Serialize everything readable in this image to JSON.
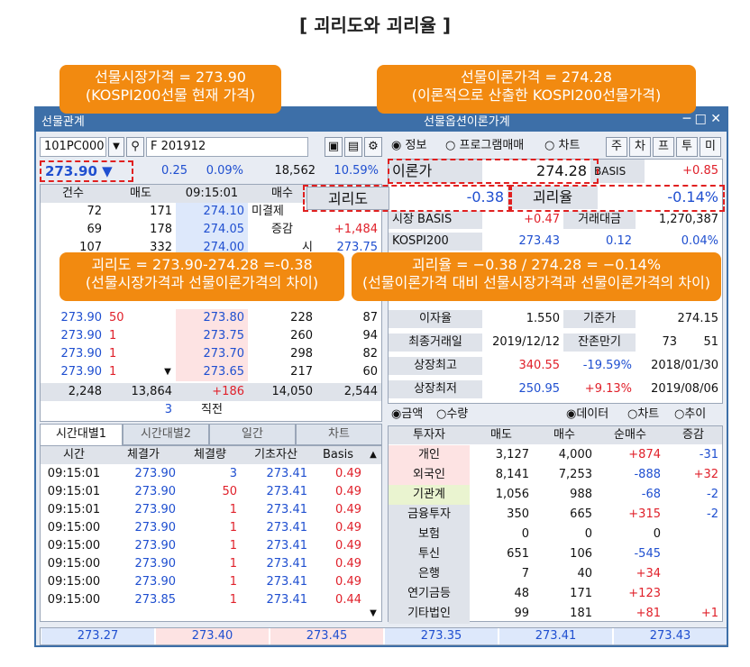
{
  "page_title": "[ 괴리도와 괴리율 ]",
  "window_title_left": "선물관계",
  "window_title_right": "선물옵션이론가계",
  "callouts": {
    "futures_price": [
      "선물시장가격 = 273.90",
      "(KOSPI200선물 현재 가격)"
    ],
    "theory_price": [
      "선물이론가격 = 274.28",
      "(이론적으로 산출한 KOSPI200선물가격)"
    ],
    "gap": [
      "괴리도 = 273.90-274.28 =-0.38",
      "(선물시장가격과 선물이론가격의 차이)"
    ],
    "gap_rate": [
      "괴리율 = −0.38 / 274.28 = −0.14%",
      "(선물이론가격 대비 선물시장가격과 선물이론가격의 차이)"
    ]
  },
  "left": {
    "code": "101PC000",
    "product": "F 201912",
    "price": "273.90 ▼",
    "change": "0.25",
    "change_pct": "0.09%",
    "volume": "18,562",
    "vol_pct": "10.59%",
    "quote_headers": [
      "건수",
      "매도",
      "09:15:01",
      "매수"
    ],
    "ask_rows": [
      [
        "72",
        "171",
        "274.10"
      ],
      [
        "69",
        "178",
        "274.05"
      ],
      [
        "107",
        "332",
        "274.00"
      ]
    ],
    "side_labels": [
      "미결제",
      "증감",
      "시"
    ],
    "side_values": [
      "+1,484",
      "273.75"
    ],
    "bid_rows": [
      [
        "273.90",
        "50",
        "273.80",
        "228",
        "87"
      ],
      [
        "273.90",
        "1",
        "273.75",
        "260",
        "94"
      ],
      [
        "273.90",
        "1",
        "273.70",
        "298",
        "82"
      ],
      [
        "273.90",
        "1",
        "273.65",
        "217",
        "60"
      ]
    ],
    "totals": [
      "2,248",
      "13,864",
      "+186",
      "14,050",
      "2,544"
    ],
    "footer": [
      "3",
      "직전"
    ],
    "tabs": [
      "시간대별1",
      "시간대별2",
      "일간",
      "차트"
    ],
    "trade_headers": [
      "시간",
      "체결가",
      "체결량",
      "기초자산",
      "Basis"
    ],
    "trades": [
      [
        "09:15:01",
        "273.90",
        "3",
        "273.41",
        "0.49"
      ],
      [
        "09:15:01",
        "273.90",
        "50",
        "273.41",
        "0.49"
      ],
      [
        "09:15:01",
        "273.90",
        "1",
        "273.41",
        "0.49"
      ],
      [
        "09:15:00",
        "273.90",
        "1",
        "273.41",
        "0.49"
      ],
      [
        "09:15:00",
        "273.90",
        "1",
        "273.41",
        "0.49"
      ],
      [
        "09:15:00",
        "273.90",
        "1",
        "273.41",
        "0.49"
      ],
      [
        "09:15:00",
        "273.90",
        "1",
        "273.41",
        "0.49"
      ],
      [
        "09:15:00",
        "273.85",
        "1",
        "273.41",
        "0.44"
      ]
    ]
  },
  "right": {
    "radios": [
      "정보",
      "프로그램매매",
      "차트"
    ],
    "buttons": [
      "주",
      "차",
      "프",
      "투",
      "미"
    ],
    "theory_label": "이론가",
    "theory_value": "274.28",
    "basis_label": "BASIS",
    "basis_value": "+0.85",
    "gap_label": "괴리도",
    "gap_value": "-0.38",
    "gap_rate_label": "괴리율",
    "gap_rate_value": "-0.14%",
    "market_basis_label": "시장 BASIS",
    "market_basis_value": "+0.47",
    "trade_amount_label": "거래대금",
    "trade_amount_value": "1,270,387",
    "kospi_label": "KOSPI200",
    "kospi_value": "273.43",
    "kospi_change": "0.12",
    "kospi_pct": "0.04%",
    "info_rows": [
      [
        "이자율",
        "1.550",
        "기준가",
        "274.15"
      ],
      [
        "최종거래일",
        "2019/12/12",
        "잔존만기",
        "73",
        "51"
      ],
      [
        "상장최고",
        "340.55",
        "-19.59%",
        "2018/01/30"
      ],
      [
        "상장최저",
        "250.95",
        "+9.13%",
        "2019/08/06"
      ]
    ],
    "radio_left": [
      "금액",
      "수량"
    ],
    "radio_right": [
      "데이터",
      "차트",
      "추이"
    ],
    "investor_headers": [
      "투자자",
      "매도",
      "매수",
      "순매수",
      "증감"
    ],
    "investors": [
      [
        "개인",
        "3,127",
        "4,000",
        "+874",
        "-31"
      ],
      [
        "외국인",
        "8,141",
        "7,253",
        "-888",
        "+32"
      ],
      [
        "기관계",
        "1,056",
        "988",
        "-68",
        "-2"
      ],
      [
        "금융투자",
        "350",
        "665",
        "+315",
        "-2"
      ],
      [
        "보험",
        "0",
        "0",
        "0",
        ""
      ],
      [
        "투신",
        "651",
        "106",
        "-545",
        ""
      ],
      [
        "은행",
        "7",
        "40",
        "+34",
        ""
      ],
      [
        "연기금등",
        "48",
        "171",
        "+123",
        ""
      ],
      [
        "기타법인",
        "99",
        "181",
        "+81",
        "+1"
      ]
    ]
  },
  "bottom_bar": [
    "273.27",
    "273.40",
    "273.45",
    "273.35",
    "273.41",
    "273.43"
  ]
}
